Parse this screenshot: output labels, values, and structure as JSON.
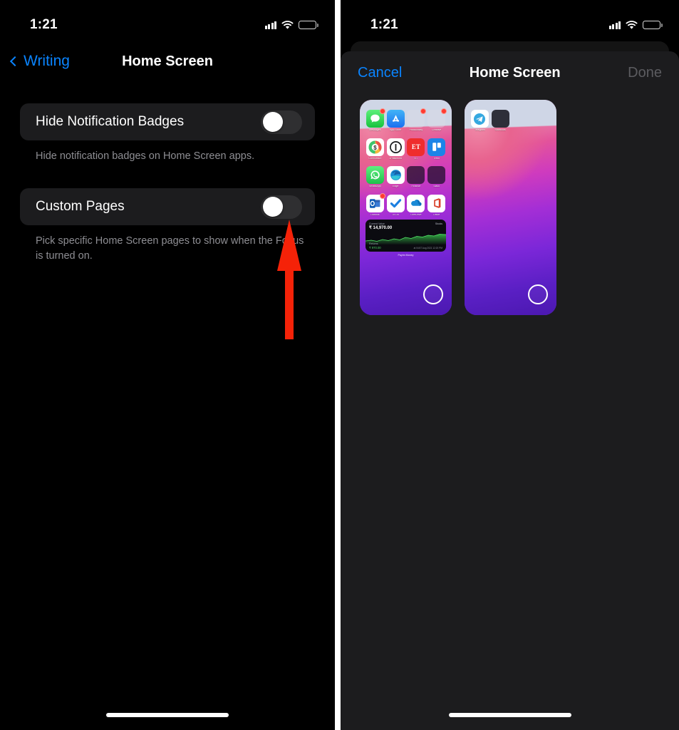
{
  "left_panel": {
    "status_bar": {
      "time": "1:21",
      "signal_icon": "cellular-bars-icon",
      "wifi_icon": "wifi-icon",
      "battery_icon": "battery-low-icon",
      "battery_level_pct": 32
    },
    "nav": {
      "back_label": "Writing",
      "back_icon": "chevron-left-icon",
      "title": "Home Screen"
    },
    "rows": [
      {
        "label": "Hide Notification Badges",
        "toggle_state": "off",
        "footnote": "Hide notification badges on Home Screen apps."
      },
      {
        "label": "Custom Pages",
        "toggle_state": "off",
        "footnote": "Pick specific Home Screen pages to show when the Focus is turned on."
      }
    ],
    "annotation": {
      "shape": "up-arrow",
      "color": "#f52208",
      "points_at": "Custom Pages toggle"
    }
  },
  "right_panel": {
    "status_bar": {
      "time": "1:21",
      "signal_icon": "cellular-bars-icon",
      "wifi_icon": "wifi-icon",
      "battery_icon": "battery-low-icon",
      "battery_level_pct": 32
    },
    "sheet": {
      "cancel_label": "Cancel",
      "title": "Home Screen",
      "done_label": "Done",
      "done_enabled": false
    },
    "pages": [
      {
        "selected": false,
        "apps": [
          {
            "name": "Messages",
            "badge": true,
            "color": "#4cd964",
            "glyph": "message"
          },
          {
            "name": "App Store",
            "badge": false,
            "color": "#2f9bf3",
            "glyph": "appstore"
          },
          {
            "name": "Productivity",
            "badge": true,
            "color": "#dcdce6",
            "glyph": "folder"
          },
          {
            "name": "Creative",
            "badge": true,
            "color": "#dcdce6",
            "glyph": "folder"
          },
          {
            "name": "CoinSwitch",
            "badge": false,
            "color": "#ffffff",
            "glyph": "coin"
          },
          {
            "name": "1Password",
            "badge": false,
            "color": "#ffffff",
            "glyph": "onepassword"
          },
          {
            "name": "ET",
            "badge": false,
            "color": "#ee2b2b",
            "glyph": "et"
          },
          {
            "name": "Trello",
            "badge": false,
            "color": "#1f8ded",
            "glyph": "trello"
          },
          {
            "name": "WhatsApp",
            "badge": false,
            "color": "#35cf5a",
            "glyph": "whatsapp"
          },
          {
            "name": "Edge",
            "badge": false,
            "color": "#ffffff",
            "glyph": "edge"
          },
          {
            "name": "Finance",
            "badge": false,
            "color": "#2a1433",
            "glyph": "folder"
          },
          {
            "name": "Slack",
            "badge": false,
            "color": "#2a1433",
            "glyph": "folder"
          },
          {
            "name": "Outlook",
            "badge": true,
            "color": "#ffffff",
            "glyph": "outlook"
          },
          {
            "name": "To Do",
            "badge": false,
            "color": "#ffffff",
            "glyph": "todo"
          },
          {
            "name": "OneDrive",
            "badge": false,
            "color": "#ffffff",
            "glyph": "onedrive"
          },
          {
            "name": "Office",
            "badge": false,
            "color": "#ffffff",
            "glyph": "office"
          }
        ],
        "widget": {
          "value_label": "Current Value",
          "value": "₹ 14,970.00",
          "tag": "Stocks",
          "return_label": "Returns",
          "return_value": "₹ 970.00",
          "timestamp": "at 04:57 Aug 2021 12:20 PM",
          "name": "Paytm Money"
        }
      },
      {
        "selected": false,
        "apps": [
          {
            "name": "Telegram",
            "badge": false,
            "color": "#ffffff",
            "glyph": "telegram"
          },
          {
            "name": "Shortcuts",
            "badge": false,
            "color": "#14141a",
            "glyph": "folder"
          }
        ],
        "widget": null
      }
    ]
  },
  "theme": {
    "accent_blue": "#0a84ff",
    "arrow_red": "#f52208",
    "sheet_bg": "#1c1c1e",
    "page_bg": "#000000",
    "footnote_gray": "#8e8e93",
    "disabled_gray": "#5c5c60"
  }
}
